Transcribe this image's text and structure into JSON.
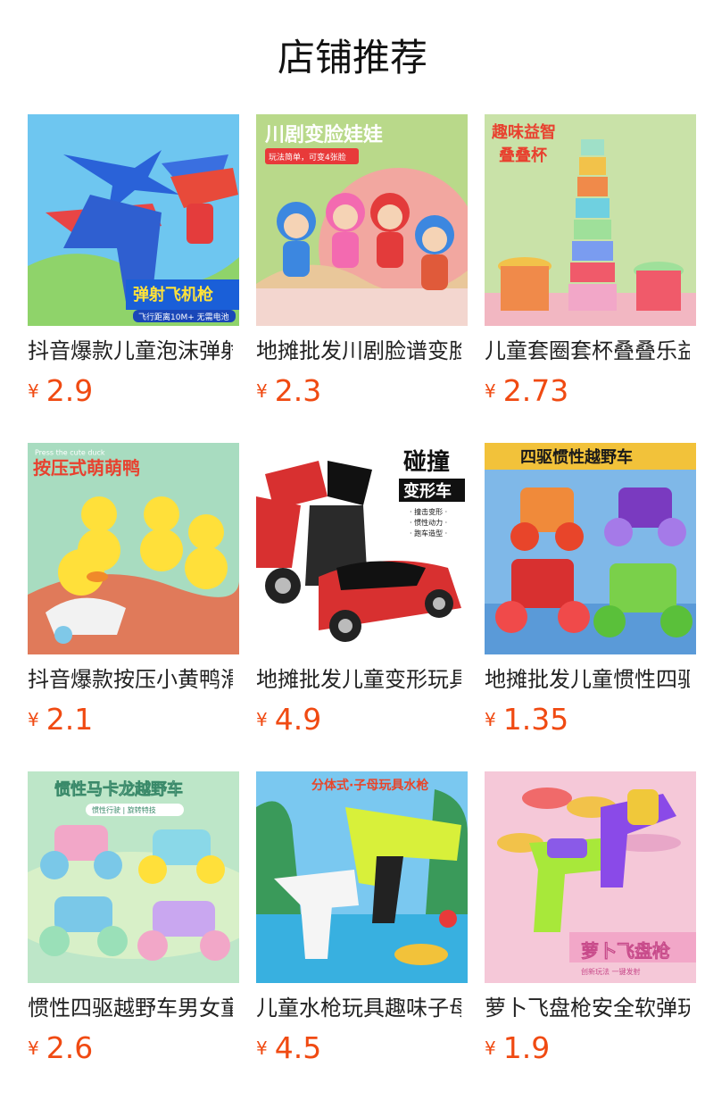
{
  "page": {
    "title": "店铺推荐"
  },
  "currency_symbol": "¥",
  "products": [
    {
      "name": "抖音爆款儿童泡沫弹射飞机枪",
      "price": "2.9",
      "banner": "弹射飞机枪",
      "sub": "飞行距离10M+ 无需电池",
      "theme": "plane"
    },
    {
      "name": "地摊批发川剧脸谱变脸娃娃",
      "price": "2.3",
      "banner": "川剧变脸娃娃",
      "sub": "玩法简单，可变4张脸",
      "theme": "faces"
    },
    {
      "name": "儿童套圈套杯叠叠乐益智玩具",
      "price": "2.73",
      "banner": "趣味益智",
      "sub": "叠叠杯",
      "theme": "cups"
    },
    {
      "name": "抖音爆款按压小黄鸭滑行车",
      "price": "2.1",
      "banner": "按压式萌萌鸭",
      "sub": "Press the cute duck",
      "theme": "ducks"
    },
    {
      "name": "地摊批发儿童变形玩具车",
      "price": "4.9",
      "banner": "碰撞",
      "sub": "变形车",
      "theme": "robot"
    },
    {
      "name": "地摊批发儿童惯性四驱越野车",
      "price": "1.35",
      "banner": "四驱惯性越野车",
      "sub": "",
      "theme": "trucks"
    },
    {
      "name": "惯性四驱越野车男女童玩具",
      "price": "2.6",
      "banner": "惯性马卡龙越野车",
      "sub": "惯性行驶 | 旋转特技",
      "theme": "macaron"
    },
    {
      "name": "儿童水枪玩具趣味子母水枪",
      "price": "4.5",
      "banner": "分体式·子母玩具水枪",
      "sub": "",
      "theme": "water"
    },
    {
      "name": "萝卜飞盘枪安全软弹玩具",
      "price": "1.9",
      "banner": "萝卜飞盘枪",
      "sub": "创新玩法 一键发射",
      "theme": "disc"
    }
  ],
  "colors": {
    "price": "#f04a12",
    "title": "#111111"
  }
}
